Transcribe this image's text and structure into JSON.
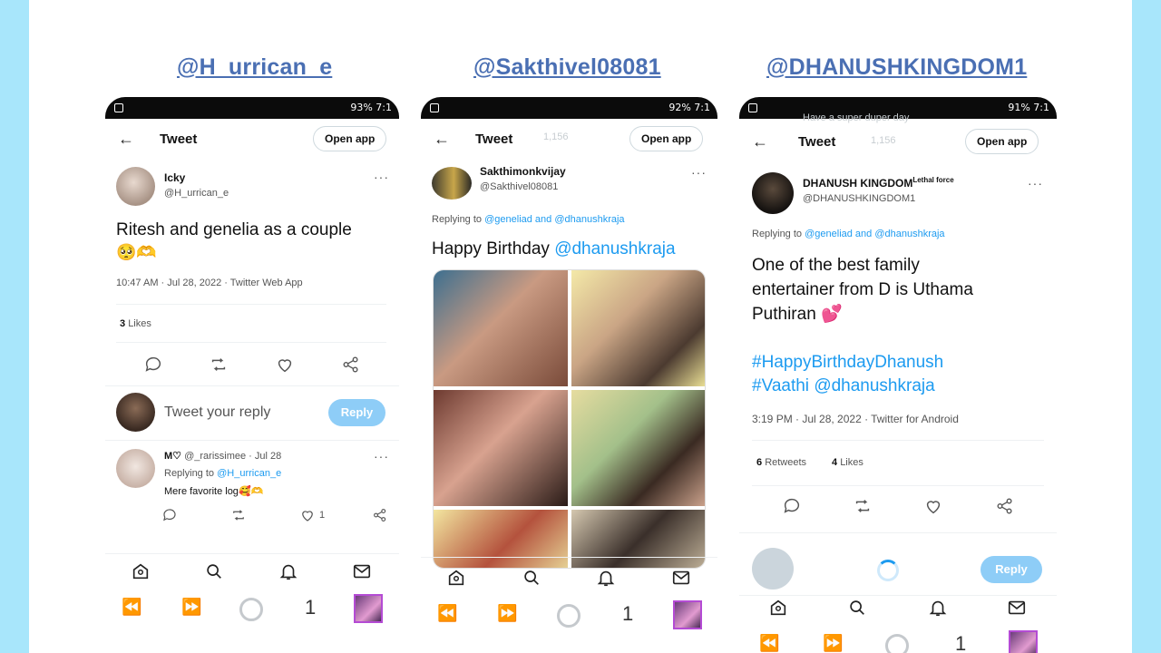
{
  "headers": [
    "@H_urrican_e",
    "@Sakthivel08081",
    "@DHANUSHKINGDOM1"
  ],
  "phones": [
    {
      "status": "93% 7:1",
      "topbar": {
        "title": "Tweet",
        "open_app": "Open app"
      },
      "tweet": {
        "name": "Icky",
        "handle": "@H_urrican_e",
        "text": "Ritesh and genelia as a couple",
        "emoji": "🥺🫶",
        "meta": "10:47 AM · Jul 28, 2022 · Twitter Web App",
        "likes_count": "3",
        "likes_label": "Likes"
      },
      "reply_box": {
        "placeholder": "Tweet your reply",
        "button": "Reply"
      },
      "reply": {
        "name": "M♡",
        "handle": "@_rarissimee · Jul 28",
        "replying_to": "Replying to",
        "replying_handle": "@H_urrican_e",
        "text": "Mere favorite log",
        "emoji": "🥰🫶",
        "likes": "1"
      },
      "sysbar_num": "1"
    },
    {
      "status": "92% 7:1",
      "topbar": {
        "title": "Tweet",
        "open_app": "Open app",
        "ghost_count": "1,156"
      },
      "tweet": {
        "name": "Sakthimonkvijay",
        "handle": "@Sakthivel08081",
        "replying_to": "Replying to",
        "replying_handles": "@geneliad and @dhanushkraja",
        "text": "Happy Birthday",
        "mention": "@dhanushkraja"
      },
      "sysbar_num": "1"
    },
    {
      "status": "91% 7:1",
      "topbar": {
        "title": "Tweet",
        "open_app": "Open app",
        "ghost_count": "1,156",
        "ghost_text": "Have a super duper day"
      },
      "tweet": {
        "name": "DHANUSH KINGDOM",
        "name_sup": "Lethal force",
        "handle": "@DHANUSHKINGDOM1",
        "replying_to": "Replying to",
        "replying_handles": "@geneliad and @dhanushkraja",
        "text_l1": "One of the best family",
        "text_l2": "entertainer from D is Uthama",
        "text_l3": "Puthiran",
        "emoji": "💕",
        "hashtag1": "#HappyBirthdayDhanush",
        "hashtag2": "#Vaathi",
        "mention": "@dhanushkraja",
        "meta": "3:19 PM · Jul 28, 2022 · Twitter for Android",
        "retweets_count": "6",
        "retweets_label": "Retweets",
        "likes_count": "4",
        "likes_label": "Likes"
      },
      "reply_box": {
        "button": "Reply"
      },
      "sysbar_num": "1"
    }
  ],
  "colors": {
    "page_bg": "#a8e6fb",
    "header": "#4a6fb3",
    "link": "#1d9bf0",
    "reply_btn": "#8ecdf7"
  }
}
